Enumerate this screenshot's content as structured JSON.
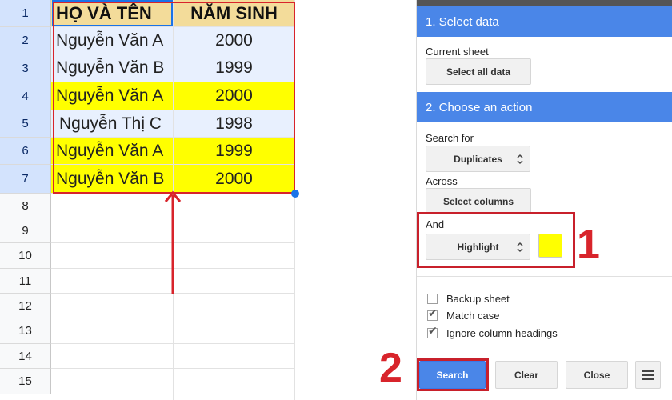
{
  "sheet": {
    "columns": {
      "name_header": "HỌ VÀ TÊN",
      "year_header": "NĂM SINH"
    },
    "row_numbers": [
      "1",
      "2",
      "3",
      "4",
      "5",
      "6",
      "7",
      "8",
      "9",
      "10",
      "11",
      "12",
      "13",
      "14",
      "15"
    ],
    "rows": [
      {
        "name": "Nguyễn Văn A",
        "year": "2000",
        "highlighted": false
      },
      {
        "name": "Nguyễn Văn B",
        "year": "1999",
        "highlighted": false
      },
      {
        "name": "Nguyễn Văn A",
        "year": "2000",
        "highlighted": true
      },
      {
        "name": "Nguyễn Thị C",
        "year": "1998",
        "highlighted": false
      },
      {
        "name": "Nguyễn Văn A",
        "year": "1999",
        "highlighted": true
      },
      {
        "name": "Nguyễn Văn B",
        "year": "2000",
        "highlighted": true
      }
    ]
  },
  "panel": {
    "section1": {
      "title": "1. Select data",
      "current_sheet_label": "Current sheet",
      "select_all_button": "Select all data"
    },
    "section2": {
      "title": "2. Choose an action",
      "search_for_label": "Search for",
      "search_for_value": "Duplicates",
      "across_label": "Across",
      "across_button": "Select columns",
      "and_label": "And",
      "and_value": "Highlight",
      "highlight_color": "#ffff00"
    },
    "options": [
      {
        "label": "Backup sheet",
        "checked": false
      },
      {
        "label": "Match case",
        "checked": true
      },
      {
        "label": "Ignore column headings",
        "checked": true
      }
    ],
    "buttons": {
      "search": "Search",
      "clear": "Clear",
      "close": "Close"
    }
  },
  "annotations": {
    "step1": "1",
    "step2": "2",
    "color": "#d8242b"
  },
  "colors": {
    "accent_blue": "#4a86e8",
    "header_fill": "#f3dc9a",
    "selection_fill": "#e8f0fe",
    "highlight": "#ffff00"
  }
}
